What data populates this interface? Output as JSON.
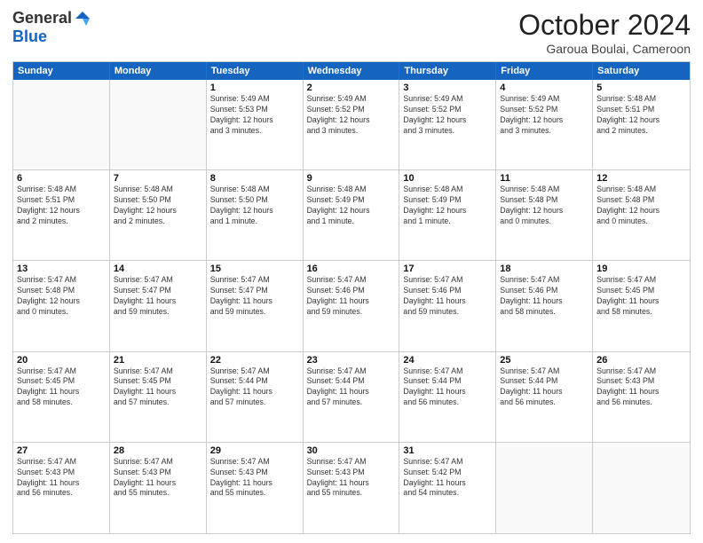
{
  "logo": {
    "general": "General",
    "blue": "Blue"
  },
  "title": "October 2024",
  "location": "Garoua Boulai, Cameroon",
  "days": [
    "Sunday",
    "Monday",
    "Tuesday",
    "Wednesday",
    "Thursday",
    "Friday",
    "Saturday"
  ],
  "weeks": [
    [
      {
        "day": "",
        "info": ""
      },
      {
        "day": "",
        "info": ""
      },
      {
        "day": "1",
        "info": "Sunrise: 5:49 AM\nSunset: 5:53 PM\nDaylight: 12 hours\nand 3 minutes."
      },
      {
        "day": "2",
        "info": "Sunrise: 5:49 AM\nSunset: 5:52 PM\nDaylight: 12 hours\nand 3 minutes."
      },
      {
        "day": "3",
        "info": "Sunrise: 5:49 AM\nSunset: 5:52 PM\nDaylight: 12 hours\nand 3 minutes."
      },
      {
        "day": "4",
        "info": "Sunrise: 5:49 AM\nSunset: 5:52 PM\nDaylight: 12 hours\nand 3 minutes."
      },
      {
        "day": "5",
        "info": "Sunrise: 5:48 AM\nSunset: 5:51 PM\nDaylight: 12 hours\nand 2 minutes."
      }
    ],
    [
      {
        "day": "6",
        "info": "Sunrise: 5:48 AM\nSunset: 5:51 PM\nDaylight: 12 hours\nand 2 minutes."
      },
      {
        "day": "7",
        "info": "Sunrise: 5:48 AM\nSunset: 5:50 PM\nDaylight: 12 hours\nand 2 minutes."
      },
      {
        "day": "8",
        "info": "Sunrise: 5:48 AM\nSunset: 5:50 PM\nDaylight: 12 hours\nand 1 minute."
      },
      {
        "day": "9",
        "info": "Sunrise: 5:48 AM\nSunset: 5:49 PM\nDaylight: 12 hours\nand 1 minute."
      },
      {
        "day": "10",
        "info": "Sunrise: 5:48 AM\nSunset: 5:49 PM\nDaylight: 12 hours\nand 1 minute."
      },
      {
        "day": "11",
        "info": "Sunrise: 5:48 AM\nSunset: 5:48 PM\nDaylight: 12 hours\nand 0 minutes."
      },
      {
        "day": "12",
        "info": "Sunrise: 5:48 AM\nSunset: 5:48 PM\nDaylight: 12 hours\nand 0 minutes."
      }
    ],
    [
      {
        "day": "13",
        "info": "Sunrise: 5:47 AM\nSunset: 5:48 PM\nDaylight: 12 hours\nand 0 minutes."
      },
      {
        "day": "14",
        "info": "Sunrise: 5:47 AM\nSunset: 5:47 PM\nDaylight: 11 hours\nand 59 minutes."
      },
      {
        "day": "15",
        "info": "Sunrise: 5:47 AM\nSunset: 5:47 PM\nDaylight: 11 hours\nand 59 minutes."
      },
      {
        "day": "16",
        "info": "Sunrise: 5:47 AM\nSunset: 5:46 PM\nDaylight: 11 hours\nand 59 minutes."
      },
      {
        "day": "17",
        "info": "Sunrise: 5:47 AM\nSunset: 5:46 PM\nDaylight: 11 hours\nand 59 minutes."
      },
      {
        "day": "18",
        "info": "Sunrise: 5:47 AM\nSunset: 5:46 PM\nDaylight: 11 hours\nand 58 minutes."
      },
      {
        "day": "19",
        "info": "Sunrise: 5:47 AM\nSunset: 5:45 PM\nDaylight: 11 hours\nand 58 minutes."
      }
    ],
    [
      {
        "day": "20",
        "info": "Sunrise: 5:47 AM\nSunset: 5:45 PM\nDaylight: 11 hours\nand 58 minutes."
      },
      {
        "day": "21",
        "info": "Sunrise: 5:47 AM\nSunset: 5:45 PM\nDaylight: 11 hours\nand 57 minutes."
      },
      {
        "day": "22",
        "info": "Sunrise: 5:47 AM\nSunset: 5:44 PM\nDaylight: 11 hours\nand 57 minutes."
      },
      {
        "day": "23",
        "info": "Sunrise: 5:47 AM\nSunset: 5:44 PM\nDaylight: 11 hours\nand 57 minutes."
      },
      {
        "day": "24",
        "info": "Sunrise: 5:47 AM\nSunset: 5:44 PM\nDaylight: 11 hours\nand 56 minutes."
      },
      {
        "day": "25",
        "info": "Sunrise: 5:47 AM\nSunset: 5:44 PM\nDaylight: 11 hours\nand 56 minutes."
      },
      {
        "day": "26",
        "info": "Sunrise: 5:47 AM\nSunset: 5:43 PM\nDaylight: 11 hours\nand 56 minutes."
      }
    ],
    [
      {
        "day": "27",
        "info": "Sunrise: 5:47 AM\nSunset: 5:43 PM\nDaylight: 11 hours\nand 56 minutes."
      },
      {
        "day": "28",
        "info": "Sunrise: 5:47 AM\nSunset: 5:43 PM\nDaylight: 11 hours\nand 55 minutes."
      },
      {
        "day": "29",
        "info": "Sunrise: 5:47 AM\nSunset: 5:43 PM\nDaylight: 11 hours\nand 55 minutes."
      },
      {
        "day": "30",
        "info": "Sunrise: 5:47 AM\nSunset: 5:43 PM\nDaylight: 11 hours\nand 55 minutes."
      },
      {
        "day": "31",
        "info": "Sunrise: 5:47 AM\nSunset: 5:42 PM\nDaylight: 11 hours\nand 54 minutes."
      },
      {
        "day": "",
        "info": ""
      },
      {
        "day": "",
        "info": ""
      }
    ]
  ]
}
